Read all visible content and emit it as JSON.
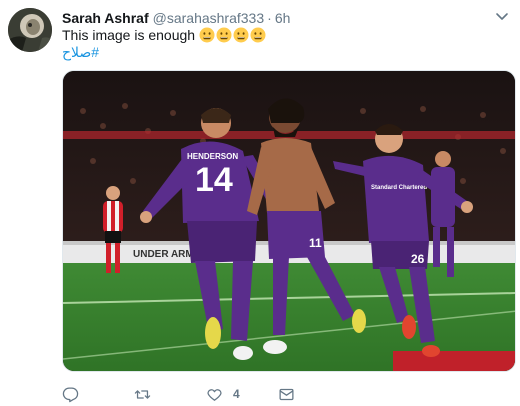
{
  "tweet": {
    "author_name": "Sarah Ashraf",
    "handle": "@sarahashraf333",
    "separator": "·",
    "time": "6h",
    "text": "This image is enough",
    "emoji": [
      "emoji-face",
      "emoji-face",
      "emoji-face",
      "emoji-face"
    ],
    "hashtag": "#صلاح",
    "media": {
      "jersey_back_text": "HENDERSON",
      "jersey_back_number": "14",
      "shorts_number_center": "11",
      "shorts_number_right": "26",
      "sponsor_text": "Standard Chartered",
      "board_text": "UNDER ARMOUR",
      "colors": {
        "kit": "#5a2d8c",
        "pitch": "#3f8a34",
        "crowd": "#2a1e1c"
      }
    },
    "actions": {
      "reply_icon": "reply-icon",
      "retweet_icon": "retweet-icon",
      "like_icon": "heart-icon",
      "like_count": "4",
      "dm_icon": "envelope-icon"
    },
    "colors": {
      "link": "#1b95e0",
      "secondary": "#657786",
      "text": "#14171a"
    }
  }
}
